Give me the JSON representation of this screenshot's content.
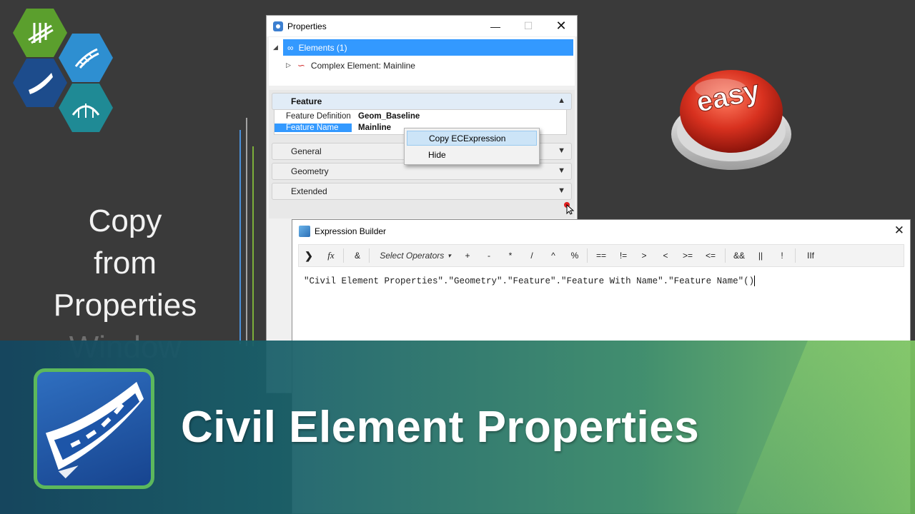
{
  "left_caption": {
    "line1": "Copy",
    "line2": "from",
    "line3": "Properties",
    "line4": "Window"
  },
  "properties_window": {
    "title": "Properties",
    "tree": {
      "root_label": "Elements (1)",
      "child_label": "Complex Element: Mainline"
    },
    "sections": {
      "feature": "Feature",
      "general": "General",
      "geometry": "Geometry",
      "extended": "Extended"
    },
    "feature_rows": [
      {
        "key": "Feature Definition",
        "value": "Geom_Baseline"
      },
      {
        "key": "Feature Name",
        "value": "Mainline"
      }
    ]
  },
  "context_menu": {
    "items": [
      "Copy ECExpression",
      "Hide"
    ]
  },
  "expression_builder": {
    "title": "Expression Builder",
    "toolbar": {
      "expand": "❯",
      "fx": "fx",
      "concat": "&",
      "select_operators": "Select Operators",
      "dropdown_arrow": "▾",
      "operators": [
        "+",
        "-",
        "*",
        "/",
        "^",
        "%",
        "==",
        "!=",
        ">",
        "<",
        ">=",
        "<=",
        "&&",
        "||",
        "!",
        "IIf"
      ]
    },
    "expression": "\"Civil Element Properties\".\"Geometry\".\"Feature\".\"Feature With Name\".\"Feature Name\"()"
  },
  "easy_button": {
    "label": "easy"
  },
  "banner": {
    "title": "Civil Element Properties"
  },
  "colors": {
    "selection": "#3399ff",
    "banner_start": "#14465f",
    "banner_end": "#6eb95a",
    "logo_border": "#5cb85c",
    "easy_red": "#d8311f"
  }
}
